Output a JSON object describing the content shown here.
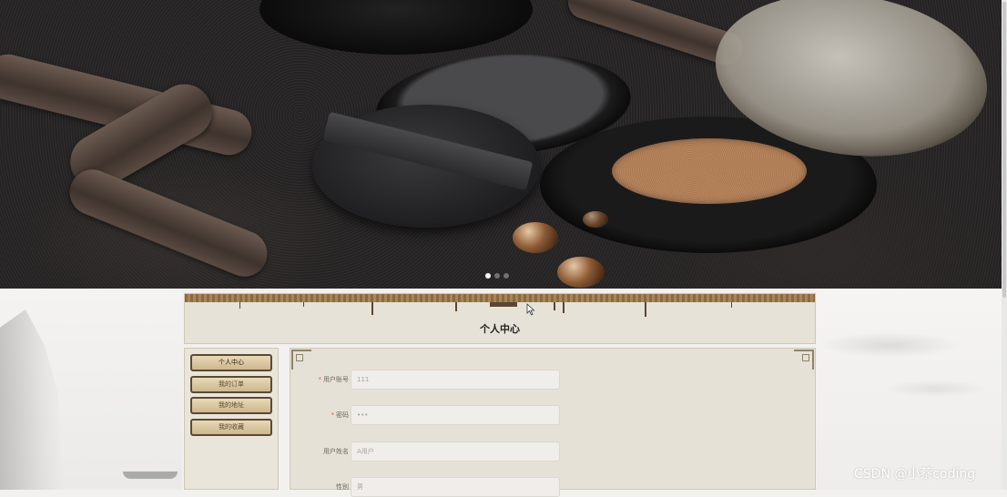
{
  "banner": {
    "slides_count": 3,
    "active_slide": 1
  },
  "header": {
    "title": "个人中心"
  },
  "sidebar": {
    "items": [
      {
        "label": "个人中心",
        "active": true
      },
      {
        "label": "我的订单",
        "active": false
      },
      {
        "label": "我的地址",
        "active": false
      },
      {
        "label": "我的收藏",
        "active": false
      }
    ]
  },
  "form": {
    "fields": [
      {
        "label": "用户账号",
        "required": true,
        "value": "111"
      },
      {
        "label": "密码",
        "required": true,
        "value": "•••"
      },
      {
        "label": "用户姓名",
        "required": false,
        "value": "A用户"
      },
      {
        "label": "性别",
        "required": false,
        "value": "男"
      }
    ]
  },
  "watermark": "CSDN @小蔡coding",
  "colors": {
    "accent_required": "#e05a4f",
    "menu_border": "#5b4a33",
    "panel_bg": "#e6e1d6"
  }
}
